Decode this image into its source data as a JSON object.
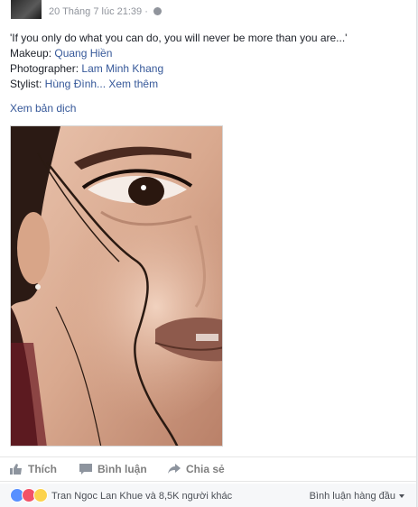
{
  "post": {
    "date": "20 Tháng 7 lúc 21:39 · ",
    "quote": "'If you only do what you can do, you will never be more than you are...'",
    "makeup_label": "Makeup: ",
    "makeup_name": "Quang Hiền",
    "photographer_label": "Photographer: ",
    "photographer_name": "Lam Minh Khang",
    "stylist_label": "Stylist: ",
    "stylist_name": "Hùng Đình",
    "more": "... Xem thêm",
    "translate": "Xem bản dịch"
  },
  "actions": {
    "like": "Thích",
    "comment": "Bình luận",
    "share": "Chia sẻ"
  },
  "reactions": {
    "summary": "Tran Ngoc Lan Khue và 8,5K người khác",
    "sort": "Bình luận hàng đầu"
  },
  "colors": {
    "link": "#365899",
    "like_blue": "#5890ff",
    "love_red": "#f25268",
    "wow_yellow": "#fcd34d"
  },
  "icons": [
    "globe-icon",
    "like-icon",
    "comment-icon",
    "share-icon",
    "like-reaction-icon",
    "love-reaction-icon",
    "wow-reaction-icon",
    "chevron-down-icon"
  ]
}
